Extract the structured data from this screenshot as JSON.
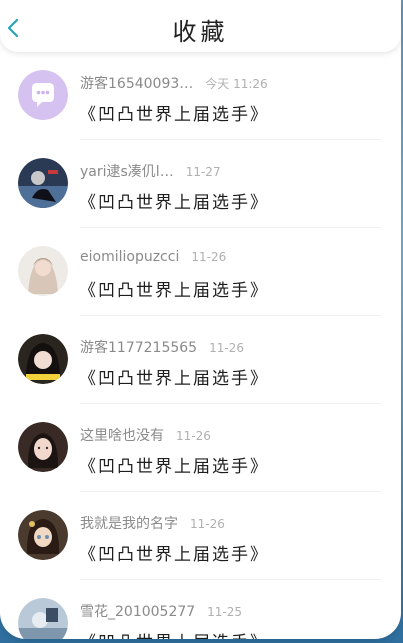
{
  "header": {
    "title": "收藏",
    "back_icon": "chevron-left-icon",
    "accent": "#2aa3b8"
  },
  "items": [
    {
      "name": "游客16540093…",
      "time": "今天 11:26",
      "content": "《凹凸世界上届选手》",
      "avatar": "chat-bubble-avatar",
      "avatar_color": "#d6c2f0"
    },
    {
      "name": "yari逮s凑仉l…",
      "time": "11-27",
      "content": "《凹凸世界上届选手》",
      "avatar": "user-avatar",
      "avatar_color": "#2a3a55"
    },
    {
      "name": "eiomiliopuzcci",
      "time": "11-26",
      "content": "《凹凸世界上届选手》",
      "avatar": "user-avatar",
      "avatar_color": "#e8e3df"
    },
    {
      "name": "游客1177215565",
      "time": "11-26",
      "content": "《凹凸世界上届选手》",
      "avatar": "user-avatar",
      "avatar_color": "#2b2520"
    },
    {
      "name": "这里啥也没有",
      "time": "11-26",
      "content": "《凹凸世界上届选手》",
      "avatar": "user-avatar",
      "avatar_color": "#3a2a26"
    },
    {
      "name": "我就是我的名字",
      "time": "11-26",
      "content": "《凹凸世界上届选手》",
      "avatar": "user-avatar",
      "avatar_color": "#4b3b2e"
    },
    {
      "name": "雪花_201005277",
      "time": "11-25",
      "content": "《凹凸世界上届选手》",
      "avatar": "user-avatar",
      "avatar_color": "#b9c9d8"
    }
  ]
}
